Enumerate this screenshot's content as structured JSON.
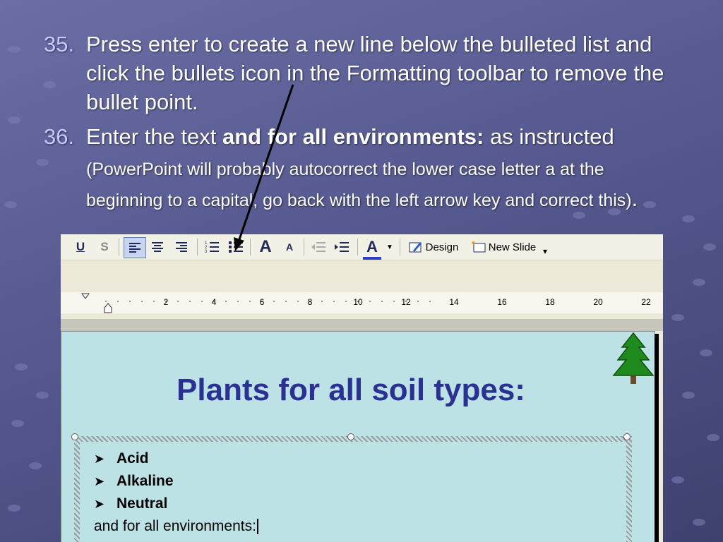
{
  "instructions": [
    {
      "number": "35.",
      "text": "Press enter to create a new line below the bulleted list and click the bullets icon in the Formatting toolbar to remove the bullet point."
    },
    {
      "number": "36.",
      "pre": "Enter the text ",
      "bold": "and for all environments:",
      "post": "  as instructed",
      "note_open": " (PowerPoint will probably autocorrect the lower case letter a at the beginning to a capital, go back with the left arrow key and correct this)",
      "note_close": "."
    }
  ],
  "toolbar": {
    "underline_label": "U",
    "shadow_label": "S",
    "grow_font_label": "A",
    "shrink_font_label": "A",
    "font_color_label": "A",
    "design_label": "Design",
    "new_slide_label": "New Slide",
    "overflow_label": "▾"
  },
  "ruler": {
    "labels": [
      "2",
      "4",
      "6",
      "8",
      "10",
      "12",
      "14",
      "16",
      "18",
      "20",
      "22"
    ]
  },
  "slide": {
    "title": "Plants for all soil types:",
    "bullets": [
      "Acid",
      "Alkaline",
      "Neutral"
    ],
    "plain_line": "and for all environments:"
  },
  "colors": {
    "background": "#5b5f97",
    "instruction_number": "#c6c8ff",
    "slide_background": "#bde2e5",
    "slide_title": "#2a3192",
    "tree": "#1e8a1e"
  },
  "icons": {
    "bullet_marker": "arrowhead-bullet",
    "tree": "pine-tree-icon",
    "pointer": "arrow-pointer"
  }
}
